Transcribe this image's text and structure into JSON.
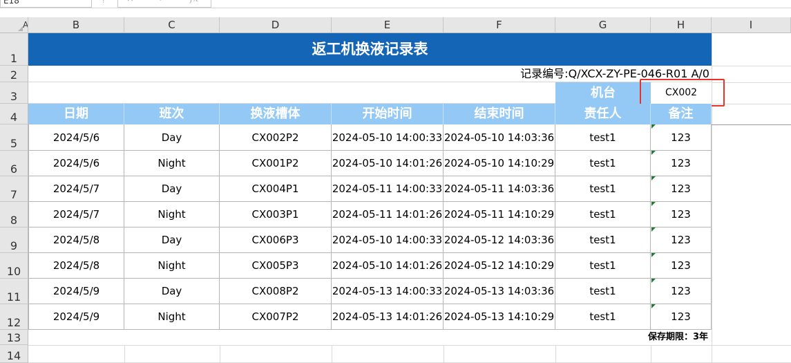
{
  "formula_bar": {
    "name_box": "E18",
    "cancel_icon": "×",
    "enter_icon": "✓",
    "fx_label": "fx"
  },
  "columns": [
    "A",
    "B",
    "C",
    "D",
    "E",
    "F",
    "G",
    "H",
    "I"
  ],
  "rows": [
    "1",
    "2",
    "3",
    "4",
    "5",
    "6",
    "7",
    "8",
    "9",
    "10",
    "11",
    "12",
    "13",
    "14"
  ],
  "sheet": {
    "title": "返工机换液记录表",
    "record_no": "记录编号:Q/XCX-ZY-PE-046-R01 A/0",
    "machine_label": "机台",
    "machine_value": "CX002",
    "headers": [
      "日期",
      "班次",
      "换液槽体",
      "开始时间",
      "结束时间",
      "责任人",
      "备注"
    ],
    "records": [
      [
        "2024/5/6",
        "Day",
        "CX002P2",
        "2024-05-10 14:00:33",
        "2024-05-10 14:03:36",
        "test1",
        "123"
      ],
      [
        "2024/5/6",
        "Night",
        "CX001P2",
        "2024-05-10 14:01:26",
        "2024-05-10 14:10:29",
        "test1",
        "123"
      ],
      [
        "2024/5/7",
        "Day",
        "CX004P1",
        "2024-05-11 14:00:33",
        "2024-05-11 14:03:36",
        "test1",
        "123"
      ],
      [
        "2024/5/7",
        "Night",
        "CX003P1",
        "2024-05-11 14:01:26",
        "2024-05-11 14:10:29",
        "test1",
        "123"
      ],
      [
        "2024/5/8",
        "Day",
        "CX006P3",
        "2024-05-10 14:00:33",
        "2024-05-12 14:03:36",
        "test1",
        "123"
      ],
      [
        "2024/5/8",
        "Night",
        "CX005P3",
        "2024-05-10 14:01:26",
        "2024-05-12 14:10:29",
        "test1",
        "123"
      ],
      [
        "2024/5/9",
        "Day",
        "CX008P2",
        "2024-05-13 14:00:33",
        "2024-05-13 14:03:36",
        "test1",
        "123"
      ],
      [
        "2024/5/9",
        "Night",
        "CX007P2",
        "2024-05-13 14:01:26",
        "2024-05-13 14:10:29",
        "test1",
        "123"
      ]
    ],
    "retention": "保存期限：3年"
  },
  "colors": {
    "title_bg": "#1565b7",
    "header_bg": "#93c9f4",
    "highlight": "#e8322b",
    "number_flag": "#1e7d32"
  }
}
